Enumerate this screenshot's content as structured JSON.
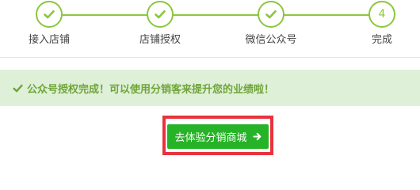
{
  "stepper": {
    "accent_color": "#8cc63f",
    "steps": [
      {
        "label": "接入店铺",
        "status": "done",
        "icon": "check-icon"
      },
      {
        "label": "店铺授权",
        "status": "done",
        "icon": "check-icon"
      },
      {
        "label": "微信公众号",
        "status": "done",
        "icon": "check-icon"
      },
      {
        "label": "完成",
        "status": "current",
        "number": "4"
      }
    ]
  },
  "alert": {
    "icon": "check-icon",
    "text": "公众号授权完成！可以使用分销客来提升您的业绩啦！",
    "text_color": "#6fa538",
    "background": "#dff0d8"
  },
  "cta": {
    "label": "去体验分销商城",
    "icon": "arrow-right-icon",
    "button_color": "#27b327",
    "highlight_color": "#e8323c"
  }
}
